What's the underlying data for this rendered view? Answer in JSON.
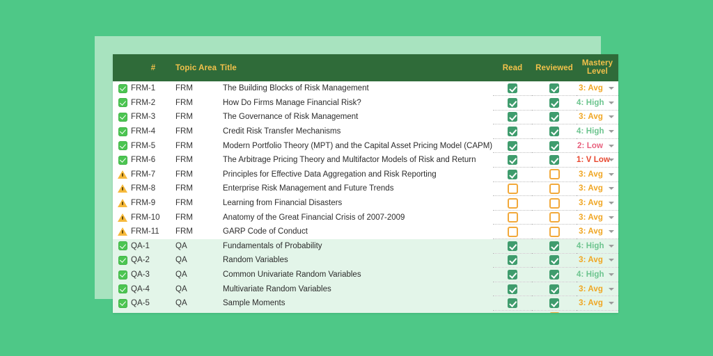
{
  "theme": {
    "page_background": "#4ec887",
    "backdrop_card": "#a8e3bf",
    "table_background": "#ffffff",
    "header_background": "#2f6b39",
    "header_text_color": "#f2c14b",
    "group_qa_row_background": "#e3f5e9",
    "checkbox_on_color": "#3f9c6d",
    "checkbox_off_color": "#f2a93b",
    "status_ok_color": "#4cc552",
    "status_warn_color": "#f6b93b"
  },
  "table": {
    "columns": [
      {
        "key": "status",
        "label": "",
        "align": "center"
      },
      {
        "key": "number",
        "label": "#",
        "align": "left"
      },
      {
        "key": "topic",
        "label": "Topic Area",
        "align": "left"
      },
      {
        "key": "title",
        "label": "Title",
        "align": "left"
      },
      {
        "key": "read",
        "label": "Read",
        "align": "center"
      },
      {
        "key": "reviewed",
        "label": "Reviewed",
        "align": "center"
      },
      {
        "key": "mastery",
        "label_line1": "Mastery",
        "label_line2": "Level",
        "align": "center"
      }
    ],
    "rows": [
      {
        "status": "check-icon",
        "number": "FRM-1",
        "topic": "FRM",
        "title": "The Building Blocks of Risk Management",
        "read": true,
        "reviewed": true,
        "mastery": "3: Avg",
        "mastery_class": "m-avg",
        "group": "frm"
      },
      {
        "status": "check-icon",
        "number": "FRM-2",
        "topic": "FRM",
        "title": "How Do Firms Manage Financial Risk?",
        "read": true,
        "reviewed": true,
        "mastery": "4: High",
        "mastery_class": "m-high",
        "group": "frm"
      },
      {
        "status": "check-icon",
        "number": "FRM-3",
        "topic": "FRM",
        "title": "The Governance of Risk Management",
        "read": true,
        "reviewed": true,
        "mastery": "3: Avg",
        "mastery_class": "m-avg",
        "group": "frm"
      },
      {
        "status": "check-icon",
        "number": "FRM-4",
        "topic": "FRM",
        "title": "Credit Risk Transfer Mechanisms",
        "read": true,
        "reviewed": true,
        "mastery": "4: High",
        "mastery_class": "m-high",
        "group": "frm"
      },
      {
        "status": "check-icon",
        "number": "FRM-5",
        "topic": "FRM",
        "title": "Modern Portfolio Theory (MPT) and the Capital Asset Pricing Model (CAPM)",
        "read": true,
        "reviewed": true,
        "mastery": "2: Low",
        "mastery_class": "m-low",
        "group": "frm"
      },
      {
        "status": "check-icon",
        "number": "FRM-6",
        "topic": "FRM",
        "title": "The Arbitrage Pricing Theory and Multifactor Models of Risk and Return",
        "read": true,
        "reviewed": true,
        "mastery": "1: V Low",
        "mastery_class": "m-vlow",
        "group": "frm"
      },
      {
        "status": "warning-icon",
        "number": "FRM-7",
        "topic": "FRM",
        "title": "Principles for Effective Data Aggregation and Risk Reporting",
        "read": true,
        "reviewed": false,
        "mastery": "3: Avg",
        "mastery_class": "m-avg",
        "group": "frm"
      },
      {
        "status": "warning-icon",
        "number": "FRM-8",
        "topic": "FRM",
        "title": "Enterprise Risk Management and Future Trends",
        "read": false,
        "reviewed": false,
        "mastery": "3: Avg",
        "mastery_class": "m-avg",
        "group": "frm"
      },
      {
        "status": "warning-icon",
        "number": "FRM-9",
        "topic": "FRM",
        "title": "Learning from Financial Disasters",
        "read": false,
        "reviewed": false,
        "mastery": "3: Avg",
        "mastery_class": "m-avg",
        "group": "frm"
      },
      {
        "status": "warning-icon",
        "number": "FRM-10",
        "topic": "FRM",
        "title": "Anatomy of the Great Financial Crisis of 2007-2009",
        "read": false,
        "reviewed": false,
        "mastery": "3: Avg",
        "mastery_class": "m-avg",
        "group": "frm"
      },
      {
        "status": "warning-icon",
        "number": "FRM-11",
        "topic": "FRM",
        "title": "GARP Code of Conduct",
        "read": false,
        "reviewed": false,
        "mastery": "3: Avg",
        "mastery_class": "m-avg",
        "group": "frm"
      },
      {
        "status": "check-icon",
        "number": "QA-1",
        "topic": "QA",
        "title": "Fundamentals of Probability",
        "read": true,
        "reviewed": true,
        "mastery": "4: High",
        "mastery_class": "m-high",
        "group": "qa"
      },
      {
        "status": "check-icon",
        "number": "QA-2",
        "topic": "QA",
        "title": "Random Variables",
        "read": true,
        "reviewed": true,
        "mastery": "3: Avg",
        "mastery_class": "m-avg",
        "group": "qa"
      },
      {
        "status": "check-icon",
        "number": "QA-3",
        "topic": "QA",
        "title": "Common Univariate Random Variables",
        "read": true,
        "reviewed": true,
        "mastery": "4: High",
        "mastery_class": "m-high",
        "group": "qa"
      },
      {
        "status": "check-icon",
        "number": "QA-4",
        "topic": "QA",
        "title": "Multivariate Random Variables",
        "read": true,
        "reviewed": true,
        "mastery": "3: Avg",
        "mastery_class": "m-avg",
        "group": "qa"
      },
      {
        "status": "check-icon",
        "number": "QA-5",
        "topic": "QA",
        "title": "Sample Moments",
        "read": true,
        "reviewed": true,
        "mastery": "3: Avg",
        "mastery_class": "m-avg",
        "group": "qa"
      },
      {
        "status": "check-icon",
        "number": "",
        "topic": "",
        "title": "",
        "read": true,
        "reviewed": false,
        "mastery": "",
        "mastery_class": "m-avg",
        "group": "qa"
      }
    ]
  }
}
